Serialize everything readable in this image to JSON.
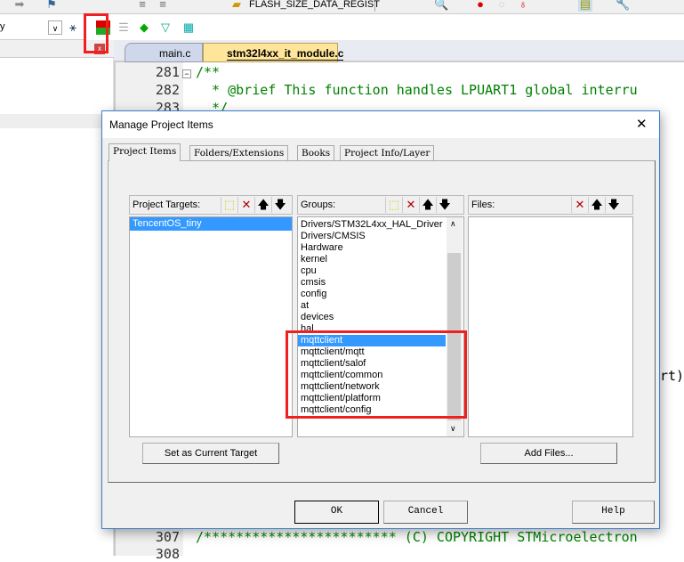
{
  "toolbar": {
    "target_select": "FLASH_SIZE_DATA_REGIST",
    "left_combo": "y"
  },
  "editor": {
    "tabs": [
      {
        "label": "main.c",
        "active": false
      },
      {
        "label": "stm32l4xx_it_module.c",
        "active": true
      }
    ],
    "lines": [
      {
        "num": "281",
        "text": "/**"
      },
      {
        "num": "282",
        "text": "  * @brief This function handles LPUART1 global interru"
      },
      {
        "num": "283",
        "text": "  */"
      }
    ],
    "partial_text": "rt)",
    "bottom_lines": [
      {
        "num": "307",
        "text": "/************************ (C) COPYRIGHT STMicroelectron"
      },
      {
        "num": "308",
        "text": ""
      }
    ]
  },
  "dialog": {
    "title": "Manage Project Items",
    "close": "✕",
    "tabs": [
      "Project Items",
      "Folders/Extensions",
      "Books",
      "Project Info/Layer"
    ],
    "targets": {
      "label": "Project Targets:",
      "items": [
        "TencentOS_tiny"
      ],
      "selected": 0,
      "button": "Set as Current Target"
    },
    "groups": {
      "label": "Groups:",
      "items": [
        "Drivers/STM32L4xx_HAL_Driver",
        "Drivers/CMSIS",
        "Hardware",
        "kernel",
        "cpu",
        "cmsis",
        "config",
        "at",
        "devices",
        "hal",
        "mqttclient",
        "mqttclient/mqtt",
        "mqttclient/salof",
        "mqttclient/common",
        "mqttclient/network",
        "mqttclient/platform",
        "mqttclient/config"
      ],
      "selected": 10
    },
    "files": {
      "label": "Files:",
      "items": [],
      "button": "Add Files..."
    },
    "ok": "OK",
    "cancel": "Cancel",
    "help": "Help"
  },
  "colors": {
    "selection": "#3399ff",
    "highlight": "#f02020",
    "tab_active": "#ffe59a",
    "code_green": "#008000"
  }
}
